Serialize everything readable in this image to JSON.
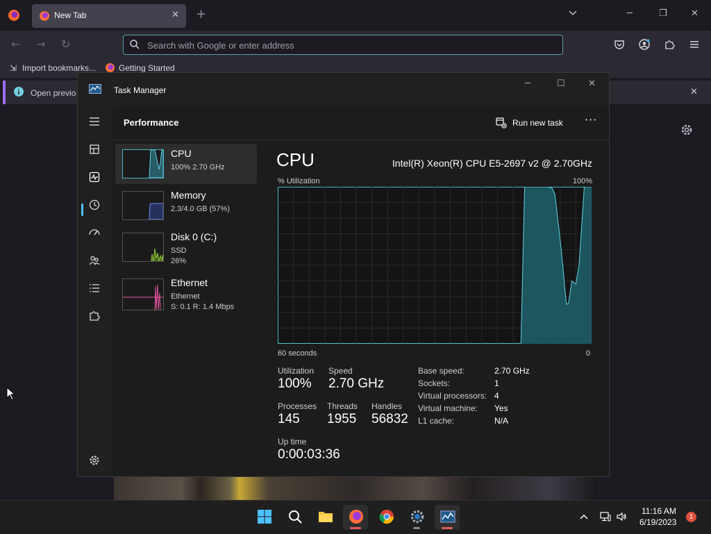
{
  "browser": {
    "tab_title": "New Tab",
    "search_placeholder": "Search with Google or enter address",
    "bookmarks": [
      "Import bookmarks...",
      "Getting Started"
    ],
    "info_text": "Open previo"
  },
  "task_manager": {
    "window_title": "Task Manager",
    "page_title": "Performance",
    "run_new_task_label": "Run new task",
    "more_label": "···",
    "devices": [
      {
        "name": "CPU",
        "line1": "100%  2.70 GHz",
        "line2": ""
      },
      {
        "name": "Memory",
        "line1": "2.3/4.0 GB (57%)",
        "line2": ""
      },
      {
        "name": "Disk 0 (C:)",
        "line1": "SSD",
        "line2": "26%"
      },
      {
        "name": "Ethernet",
        "line1": "Ethernet",
        "line2": "S: 0.1  R: 1.4 Mbps"
      }
    ],
    "detail": {
      "title": "CPU",
      "model": "Intel(R) Xeon(R) CPU E5-2697 v2 @ 2.70GHz",
      "y_label": "% Utilization",
      "y_max_label": "100%",
      "x_left_label": "60 seconds",
      "x_right_label": "0",
      "stats": {
        "utilization_label": "Utilization",
        "utilization": "100%",
        "speed_label": "Speed",
        "speed": "2.70 GHz",
        "processes_label": "Processes",
        "processes": "145",
        "threads_label": "Threads",
        "threads": "1955",
        "handles_label": "Handles",
        "handles": "56832",
        "uptime_label": "Up time",
        "uptime": "0:00:03:36"
      },
      "specs": [
        {
          "key": "Base speed:",
          "value": "2.70 GHz"
        },
        {
          "key": "Sockets:",
          "value": "1"
        },
        {
          "key": "Virtual processors:",
          "value": "4"
        },
        {
          "key": "Virtual machine:",
          "value": "Yes"
        },
        {
          "key": "L1 cache:",
          "value": "N/A"
        }
      ]
    }
  },
  "chart_data": {
    "type": "area",
    "y_label": "% Utilization",
    "x_label": "60 seconds",
    "xlim": [
      60,
      0
    ],
    "ylim": [
      0,
      100
    ],
    "x": [
      60,
      13.5,
      12.8,
      8.8,
      8.4,
      7.5,
      7.0,
      5.8,
      4.8,
      4.4,
      3.8,
      3.0,
      2.4,
      1.4,
      0.6,
      0
    ],
    "values": [
      0,
      0,
      100,
      100,
      100,
      99,
      95,
      60,
      25,
      26,
      40,
      38,
      50,
      100,
      100,
      100
    ],
    "color": "#41b8c8"
  },
  "taskbar": {
    "time": "11:16 AM",
    "date": "6/19/2023",
    "notification_count": "1"
  },
  "colors": {
    "accent": "#4cc2ff",
    "cpu": "#41b8c8",
    "memory": "#6a8cff",
    "disk": "#8ec63f",
    "ethernet": "#e0559d"
  }
}
